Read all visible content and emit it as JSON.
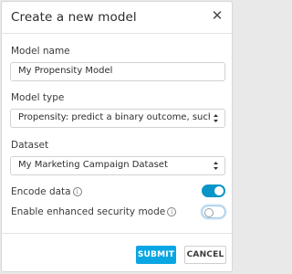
{
  "dialog": {
    "title": "Create a new model",
    "close_icon": "close-icon",
    "model_name": {
      "label": "Model name",
      "value": "My Propensity Model"
    },
    "model_type": {
      "label": "Model type",
      "selected": "Propensity: predict a binary outcome, such as"
    },
    "dataset": {
      "label": "Dataset",
      "selected": "My Marketing Campaign Dataset"
    },
    "encode_data": {
      "label": "Encode data",
      "enabled": true
    },
    "enhanced_security": {
      "label": "Enable enhanced security mode",
      "enabled": false
    },
    "buttons": {
      "submit": "SUBMIT",
      "cancel": "CANCEL"
    }
  },
  "colors": {
    "primary": "#0aa6e3",
    "toggle_on": "#0a95c8",
    "border": "#d2d2d2"
  }
}
